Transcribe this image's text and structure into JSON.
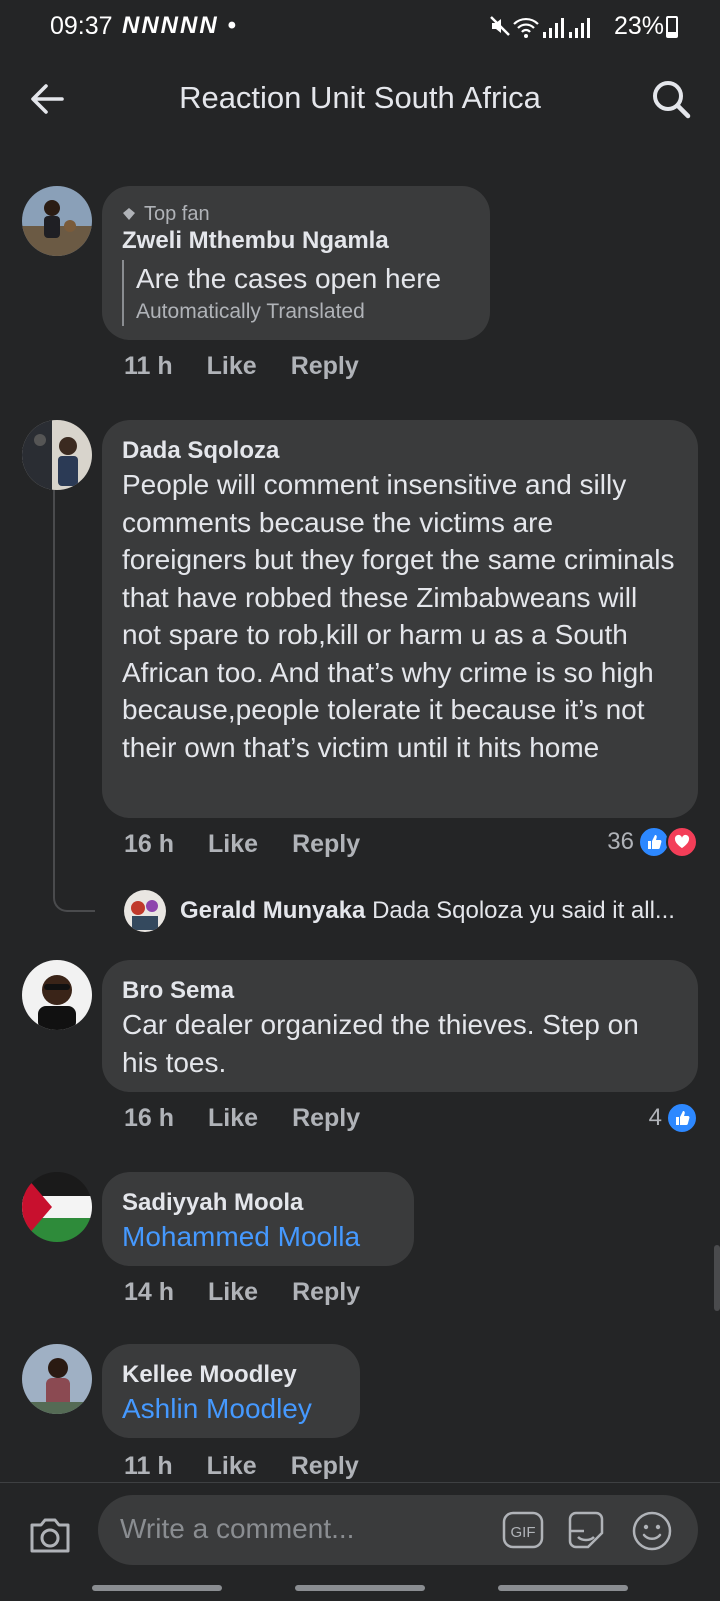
{
  "status_bar": {
    "time": "09:37",
    "notif_icons": "NNNNN •",
    "battery": "23%",
    "battery_level": 0.23
  },
  "header": {
    "title": "Reaction Unit South Africa",
    "back_icon": "arrow-left-icon",
    "search_icon": "search-icon"
  },
  "comments": [
    {
      "badge": "Top fan",
      "author": "Zweli Mthembu Ngamla",
      "text": "Are the cases open here",
      "translated_note": "Automatically Translated",
      "time": "11 h",
      "like": "Like",
      "reply": "Reply"
    },
    {
      "author": "Dada Sqoloza",
      "text": "People will comment insensitive and silly comments because the victims are foreigners but they forget the same criminals that have robbed these Zimbabweans will not spare to rob,kill or harm u as a South African too. And that’s why crime is so high because,people tolerate it because it’s not their own that’s victim until it hits home",
      "time": "16 h",
      "like": "Like",
      "reply": "Reply",
      "reaction_count": "36",
      "reply_preview": {
        "author": "Gerald Munyaka",
        "text": "Dada Sqoloza  yu said it all..."
      }
    },
    {
      "author": "Bro Sema",
      "text": "Car dealer organized  the thieves. Step on his toes.",
      "time": "16 h",
      "like": "Like",
      "reply": "Reply",
      "reaction_count": "4"
    },
    {
      "author": "Sadiyyah Moola",
      "mention": "Mohammed Moolla",
      "time": "14 h",
      "like": "Like",
      "reply": "Reply"
    },
    {
      "author": "Kellee Moodley",
      "mention": "Ashlin Moodley",
      "time": "11 h",
      "like": "Like",
      "reply": "Reply"
    }
  ],
  "composer": {
    "placeholder": "Write a comment...",
    "gif_label": "GIF"
  },
  "colors": {
    "background": "#242526",
    "bubble": "#3a3b3c",
    "mention": "#4599ff",
    "like_reaction": "#2d88ff",
    "love_reaction": "#f33e58"
  }
}
